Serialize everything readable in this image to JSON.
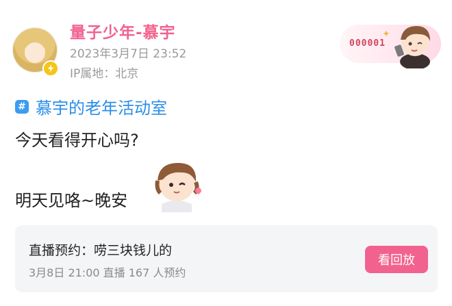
{
  "user": {
    "name": "量子少年-慕宇",
    "timestamp": "2023年3月7日 23:52",
    "ip_location": "IP属地：北京",
    "verified_icon": "lightning-icon"
  },
  "fan_card": {
    "number": "000001"
  },
  "topic": {
    "icon": "hashtag-icon",
    "label": "慕宇的老年活动室"
  },
  "post": {
    "line1": "今天看得开心吗?",
    "line2": "明天见咯~晚安"
  },
  "live_reservation": {
    "title": "直播预约：唠三块钱儿的",
    "meta": "3月8日 21:00 直播   167 人预约",
    "button_label": "看回放"
  },
  "colors": {
    "accent_pink": "#f2628f",
    "topic_blue": "#2a8ee8",
    "meta_gray": "#9a9a9a"
  }
}
